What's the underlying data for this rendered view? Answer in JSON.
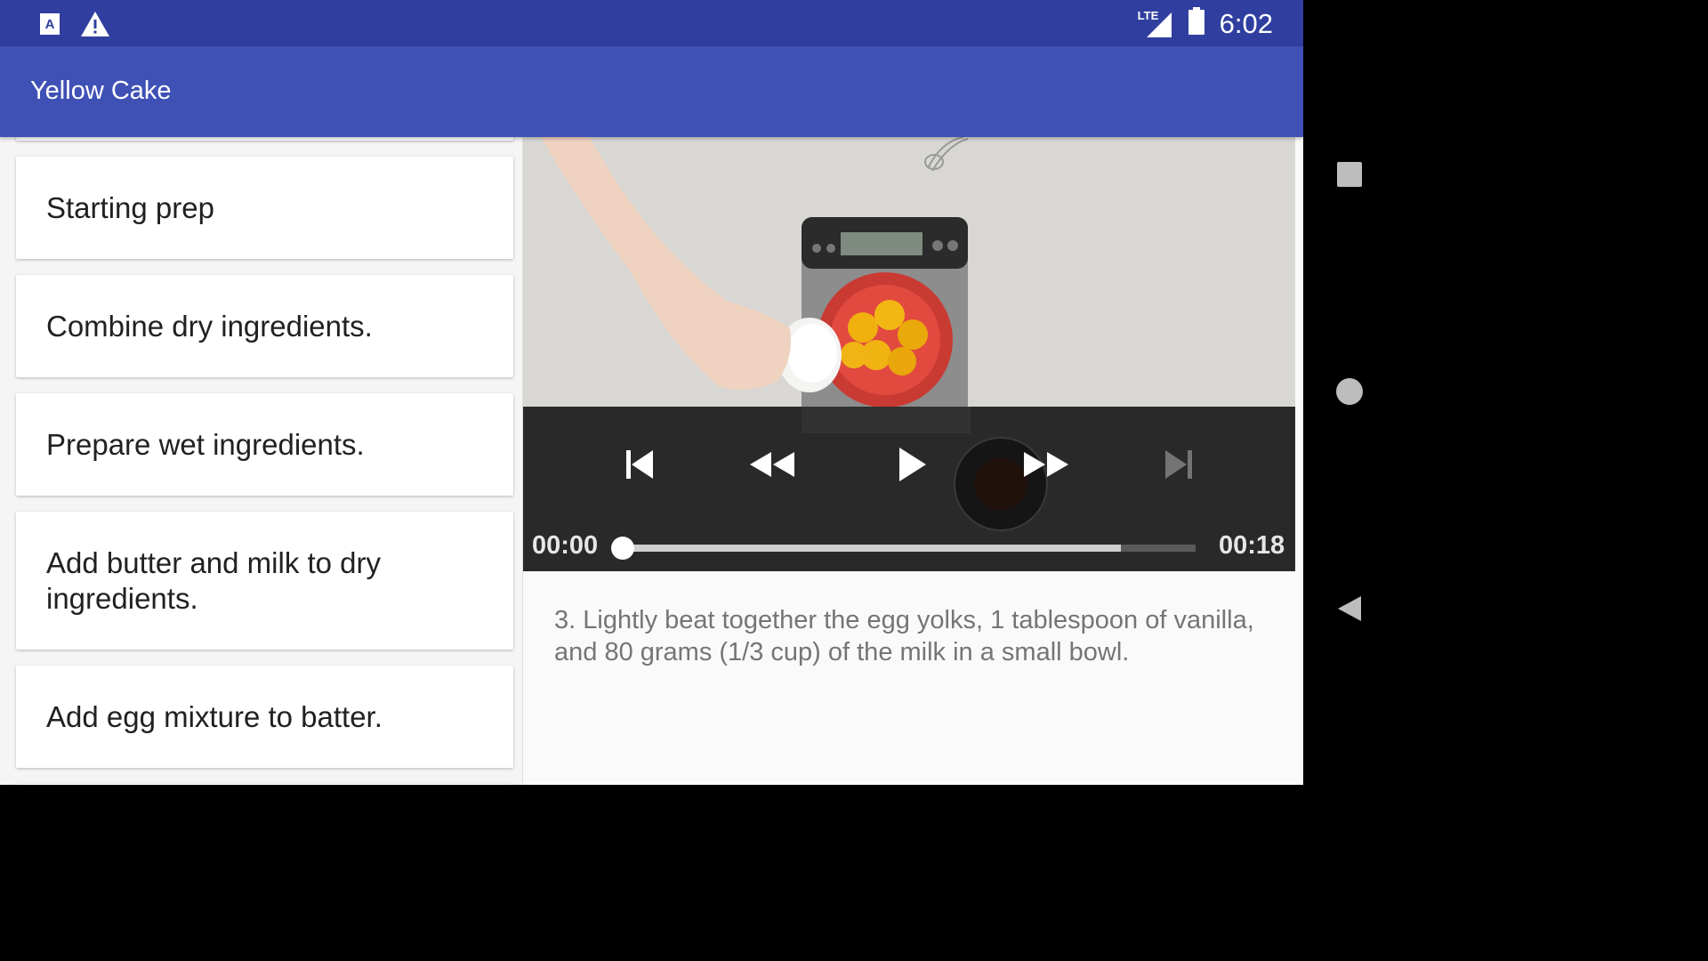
{
  "status_bar": {
    "time": "6:02",
    "network": "LTE",
    "left_icons": [
      "accessibility-icon",
      "warning-icon"
    ],
    "right_icons": [
      "signal-icon",
      "battery-icon"
    ]
  },
  "app_bar": {
    "title": "Yellow Cake"
  },
  "steps": [
    {
      "label": "Starting prep"
    },
    {
      "label": "Combine dry ingredients."
    },
    {
      "label": "Prepare wet ingredients."
    },
    {
      "label": "Add butter and milk to dry ingredients."
    },
    {
      "label": "Add egg mixture to batter."
    }
  ],
  "player": {
    "current_time": "00:00",
    "duration": "00:18",
    "progress": 0.0,
    "buffered": 0.87,
    "controls": [
      "skip-previous-icon",
      "rewind-icon",
      "play-icon",
      "fast-forward-icon",
      "skip-next-icon"
    ]
  },
  "step_description": "3. Lightly beat together the egg yolks, 1 tablespoon of vanilla, and 80 grams (1/3 cup) of the milk in a small bowl.",
  "nav_bar": {
    "buttons": [
      "recents-icon",
      "home-icon",
      "back-icon"
    ]
  },
  "colors": {
    "primary": "#3f51b5",
    "primary_dark": "#303f9f"
  }
}
